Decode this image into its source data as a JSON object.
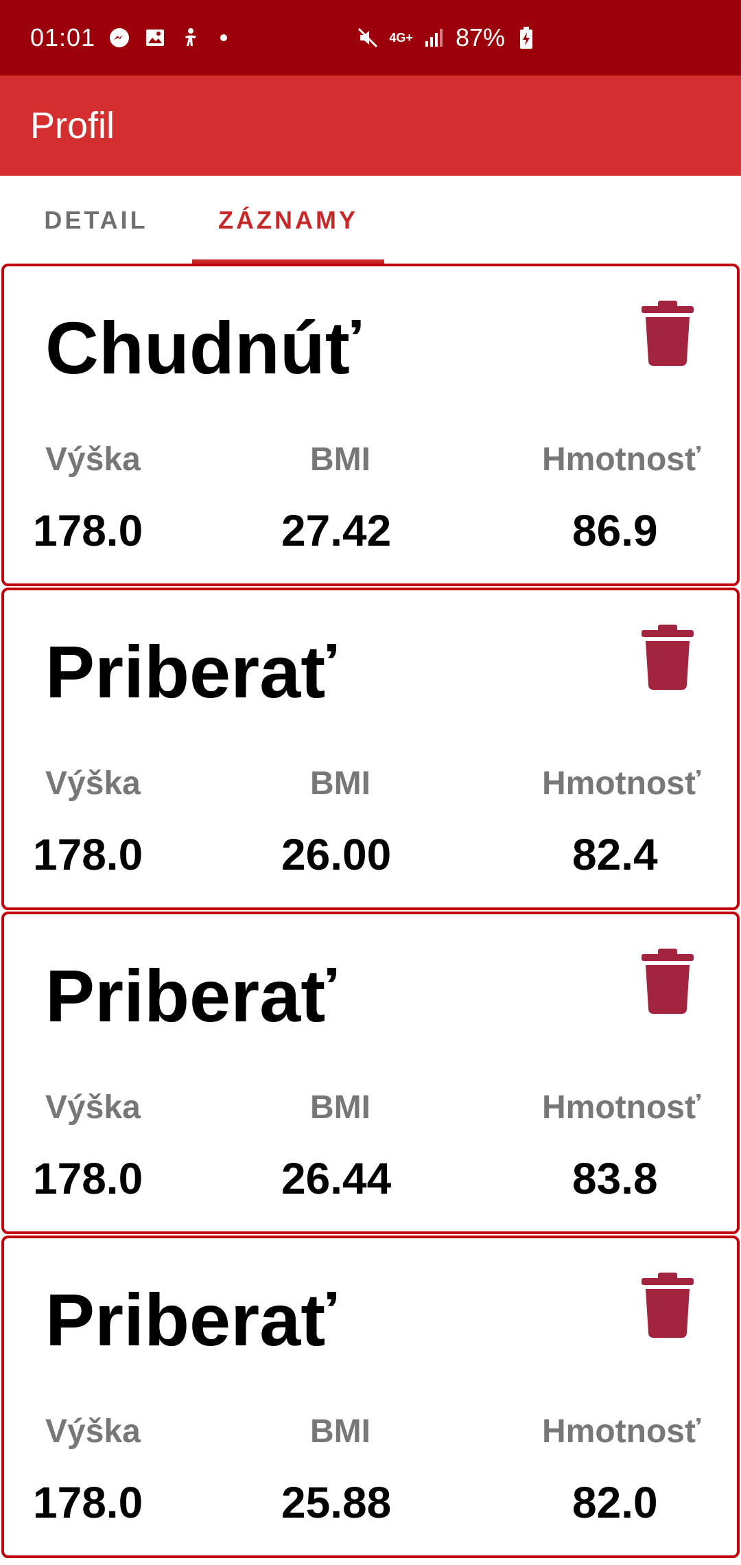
{
  "status_bar": {
    "time": "01:01",
    "network": "4G+",
    "battery": "87%",
    "icons": [
      "messenger-icon",
      "gallery-icon",
      "accessibility-icon",
      "mute-icon",
      "signal-icon",
      "battery-charging-icon"
    ]
  },
  "app_bar": {
    "title": "Profil"
  },
  "tabs": [
    {
      "label": "DETAIL",
      "selected": false
    },
    {
      "label": "ZÁZNAMY",
      "selected": true
    }
  ],
  "colors": {
    "status_bar": "#9b000b",
    "app_bar": "#d32f2f",
    "accent": "#c62828",
    "card_border": "#c1000e",
    "delete_icon": "#a3243f"
  },
  "records": [
    {
      "goal": "Chudnúť",
      "height_label": "Výška",
      "height": "178.0",
      "bmi_label": "BMI",
      "bmi": "27.42",
      "weight_label": "Hmotnosť",
      "weight": "86.9"
    },
    {
      "goal": "Priberať",
      "height_label": "Výška",
      "height": "178.0",
      "bmi_label": "BMI",
      "bmi": "26.00",
      "weight_label": "Hmotnosť",
      "weight": "82.4"
    },
    {
      "goal": "Priberať",
      "height_label": "Výška",
      "height": "178.0",
      "bmi_label": "BMI",
      "bmi": "26.44",
      "weight_label": "Hmotnosť",
      "weight": "83.8"
    },
    {
      "goal": "Priberať",
      "height_label": "Výška",
      "height": "178.0",
      "bmi_label": "BMI",
      "bmi": "25.88",
      "weight_label": "Hmotnosť",
      "weight": "82.0"
    }
  ]
}
